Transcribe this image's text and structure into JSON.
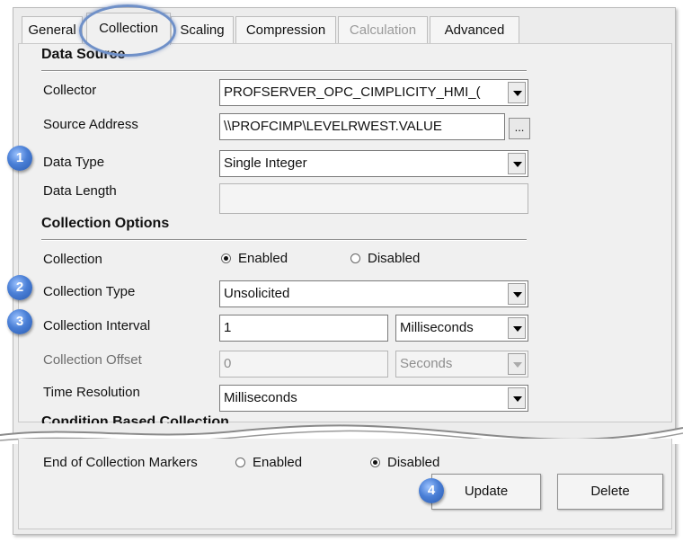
{
  "tabs": [
    {
      "label": "General"
    },
    {
      "label": "Collection"
    },
    {
      "label": "Scaling"
    },
    {
      "label": "Compression"
    },
    {
      "label": "Calculation"
    },
    {
      "label": "Advanced"
    }
  ],
  "data_source": {
    "title": "Data Source",
    "collector_label": "Collector",
    "collector_value": "PROFSERVER_OPC_CIMPLICITY_HMI_(",
    "source_address_label": "Source Address",
    "source_address_value": "\\\\PROFCIMP\\LEVELRWEST.VALUE",
    "browse_label": "...",
    "data_type_label": "Data Type",
    "data_type_value": "Single Integer",
    "data_length_label": "Data Length",
    "data_length_value": ""
  },
  "collection_options": {
    "title": "Collection Options",
    "collection_label": "Collection",
    "enabled_label": "Enabled",
    "disabled_label": "Disabled",
    "collection_type_label": "Collection Type",
    "collection_type_value": "Unsolicited",
    "collection_interval_label": "Collection Interval",
    "collection_interval_value": "1",
    "collection_interval_unit": "Milliseconds",
    "collection_offset_label": "Collection Offset",
    "collection_offset_value": "0",
    "collection_offset_unit": "Seconds",
    "time_resolution_label": "Time Resolution",
    "time_resolution_value": "Milliseconds",
    "condition_title": "Condition Based Collection"
  },
  "lower": {
    "end_markers_label": "End of Collection Markers",
    "enabled_label": "Enabled",
    "disabled_label": "Disabled",
    "update_label": "Update",
    "delete_label": "Delete"
  },
  "badges": [
    "1",
    "2",
    "3",
    "4"
  ],
  "colors": {
    "highlight": "#6f90c8",
    "badge": "#4a7fd6"
  }
}
